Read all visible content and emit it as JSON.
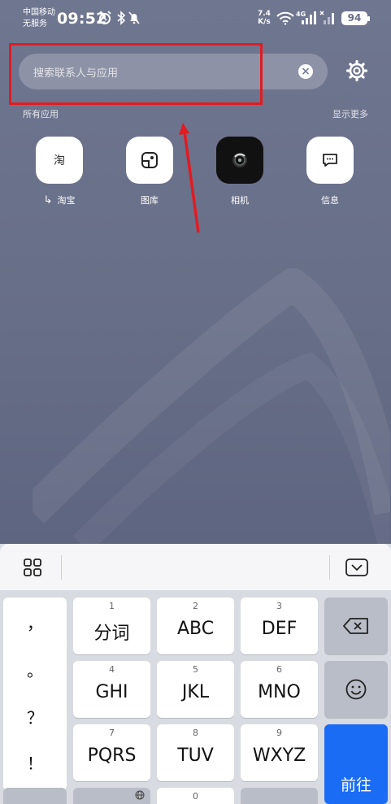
{
  "status_bar": {
    "carrier_line1": "中国移动",
    "carrier_line2": "无服务",
    "time": "09:52",
    "net_speed_value": "7.4",
    "net_speed_unit": "K/s",
    "network_type": "4G",
    "battery": "94"
  },
  "search": {
    "placeholder": "搜索联系人与应用",
    "clear_icon": "close-circle-icon",
    "settings_icon": "gear-icon"
  },
  "apps_section": {
    "title": "所有应用",
    "show_more": "显示更多",
    "apps": [
      {
        "label": "淘宝",
        "glyph": "淘",
        "redirect_glyph": "↳"
      },
      {
        "label": "图库",
        "glyph": ""
      },
      {
        "label": "相机",
        "glyph": ""
      },
      {
        "label": "信息",
        "glyph": ""
      }
    ]
  },
  "keyboard": {
    "punctuation": [
      "，",
      "。",
      "？",
      "！"
    ],
    "keys": [
      {
        "num": "1",
        "label": "分词"
      },
      {
        "num": "2",
        "label": "ABC"
      },
      {
        "num": "3",
        "label": "DEF"
      },
      {
        "num": "4",
        "label": "GHI"
      },
      {
        "num": "5",
        "label": "JKL"
      },
      {
        "num": "6",
        "label": "MNO"
      },
      {
        "num": "7",
        "label": "PQRS"
      },
      {
        "num": "8",
        "label": "TUV"
      },
      {
        "num": "9",
        "label": "WXYZ"
      },
      {
        "num": "0",
        "label": ""
      }
    ],
    "go_label": "前往",
    "colors": {
      "go": "#1a6cf5",
      "annotation": "#e11b22"
    }
  }
}
